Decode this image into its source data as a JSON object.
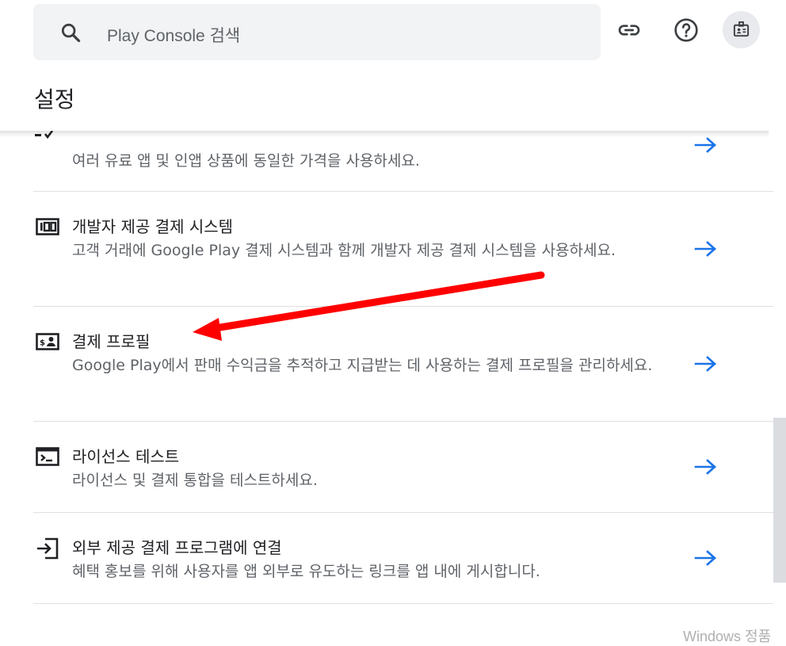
{
  "search": {
    "placeholder": "Play Console 검색"
  },
  "header": {
    "icons": [
      "link-icon",
      "help-icon",
      "account-icon"
    ],
    "page_title": "설정"
  },
  "settings": [
    {
      "icon": "price-tag-icon",
      "title": "",
      "description": "여러 유료 앱 및 인앱 상품에 동일한 가격을 사용하세요.",
      "partially_hidden": true
    },
    {
      "icon": "dev-billing-icon",
      "title": "개발자 제공 결제 시스템",
      "description": "고객 거래에 Google Play 결제 시스템과 함께 개발자 제공 결제 시스템을 사용하세요."
    },
    {
      "icon": "payments-profile-icon",
      "title": "결제 프로필",
      "description": "Google Play에서 판매 수익금을 추적하고 지급받는 데 사용하는 결제 프로필을 관리하세요."
    },
    {
      "icon": "terminal-icon",
      "title": "라이선스 테스트",
      "description": "라이선스 및 결제 통합을 테스트하세요."
    },
    {
      "icon": "external-link-in-icon",
      "title": "외부 제공 결제 프로그램에 연결",
      "description": "혜택 홍보를 위해 사용자를 앱 외부로 유도하는 링크를 앱 내에 게시합니다."
    }
  ],
  "row_arrow_icon": "arrow-right-icon",
  "annotation": {
    "type": "red-arrow",
    "color": "#ff0000",
    "points_to": "결제 프로필"
  },
  "watermark": "Windows 정품",
  "colors": {
    "accent": "#1a73e8",
    "text": "#202124",
    "secondary": "#5f6368",
    "divider": "#e0e0e0"
  }
}
